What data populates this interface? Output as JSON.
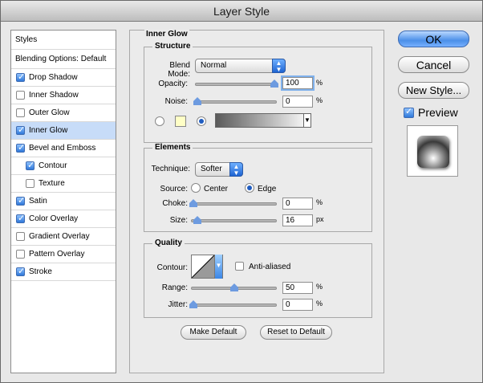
{
  "dialog": {
    "title": "Layer Style"
  },
  "sidebar": {
    "styles_label": "Styles",
    "blending_label": "Blending Options: Default",
    "items": [
      {
        "label": "Drop Shadow",
        "checked": true
      },
      {
        "label": "Inner Shadow",
        "checked": false
      },
      {
        "label": "Outer Glow",
        "checked": false
      },
      {
        "label": "Inner Glow",
        "checked": true,
        "selected": true
      },
      {
        "label": "Bevel and Emboss",
        "checked": true
      },
      {
        "label": "Contour",
        "checked": true,
        "indent": true
      },
      {
        "label": "Texture",
        "checked": false,
        "indent": true
      },
      {
        "label": "Satin",
        "checked": true
      },
      {
        "label": "Color Overlay",
        "checked": true
      },
      {
        "label": "Gradient Overlay",
        "checked": false
      },
      {
        "label": "Pattern Overlay",
        "checked": false
      },
      {
        "label": "Stroke",
        "checked": true
      }
    ]
  },
  "panel": {
    "title": "Inner Glow",
    "structure": {
      "title": "Structure",
      "blend_mode_label": "Blend Mode:",
      "blend_mode_value": "Normal",
      "opacity_label": "Opacity:",
      "opacity_value": "100",
      "opacity_slider": 100,
      "noise_label": "Noise:",
      "noise_value": "0",
      "noise_slider": 0,
      "percent": "%",
      "swatch_color": "#ffffc6"
    },
    "elements": {
      "title": "Elements",
      "technique_label": "Technique:",
      "technique_value": "Softer",
      "source_label": "Source:",
      "center_label": "Center",
      "edge_label": "Edge",
      "choke_label": "Choke:",
      "choke_value": "0",
      "choke_slider": 0,
      "size_label": "Size:",
      "size_value": "16",
      "size_slider": 16,
      "px": "px",
      "percent": "%"
    },
    "quality": {
      "title": "Quality",
      "contour_label": "Contour:",
      "antialiased_label": "Anti-aliased",
      "range_label": "Range:",
      "range_value": "50",
      "range_slider": 50,
      "jitter_label": "Jitter:",
      "jitter_value": "0",
      "jitter_slider": 0,
      "percent": "%"
    },
    "make_default": "Make Default",
    "reset_default": "Reset to Default"
  },
  "actions": {
    "ok": "OK",
    "cancel": "Cancel",
    "new_style": "New Style...",
    "preview_label": "Preview",
    "preview_checked": true
  },
  "colors": {
    "accent": "#2f78d9",
    "selection": "#c7dcf8"
  }
}
